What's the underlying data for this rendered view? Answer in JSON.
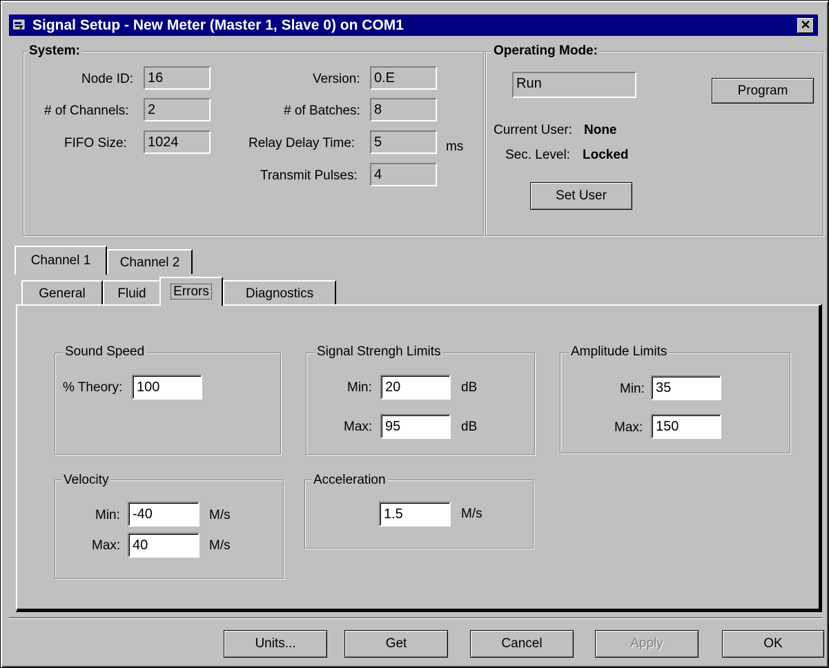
{
  "window": {
    "title": "Signal Setup - New Meter (Master 1, Slave 0) on COM1",
    "close": "✕"
  },
  "system": {
    "group_label": "System:",
    "node_id_label": "Node ID:",
    "node_id": "16",
    "channels_label": "# of Channels:",
    "channels": "2",
    "fifo_label": "FIFO Size:",
    "fifo": "1024",
    "version_label": "Version:",
    "version": "0.E",
    "batches_label": "# of Batches:",
    "batches": "8",
    "relay_label": "Relay Delay Time:",
    "relay": "5",
    "relay_unit": "ms",
    "pulses_label": "Transmit Pulses:",
    "pulses": "4"
  },
  "operating_mode": {
    "group_label": "Operating Mode:",
    "mode": "Run",
    "program_button": "Program",
    "current_user_label": "Current User:",
    "current_user": "None",
    "sec_level_label": "Sec. Level:",
    "sec_level": "Locked",
    "set_user_button": "Set User"
  },
  "channel_tabs": [
    "Channel 1",
    "Channel 2"
  ],
  "sub_tabs": [
    "General",
    "Fluid",
    "Errors",
    "Diagnostics"
  ],
  "errors": {
    "sound_speed": {
      "label": "Sound Speed",
      "theory_label": "% Theory:",
      "theory": "100"
    },
    "signal_strength": {
      "label": "Signal Strengh Limits",
      "min_label": "Min:",
      "min": "20",
      "max_label": "Max:",
      "max": "95",
      "unit": "dB"
    },
    "amplitude": {
      "label": "Amplitude Limits",
      "min_label": "Min:",
      "min": "35",
      "max_label": "Max:",
      "max": "150"
    },
    "velocity": {
      "label": "Velocity",
      "min_label": "Min:",
      "min": "-40",
      "max_label": "Max:",
      "max": "40",
      "unit": "M/s"
    },
    "acceleration": {
      "label": "Acceleration",
      "value": "1.5",
      "unit": "M/s"
    }
  },
  "buttons": {
    "units": "Units...",
    "get": "Get",
    "cancel": "Cancel",
    "apply": "Apply",
    "ok": "OK"
  },
  "colors": {
    "titlebar": "#000080",
    "face": "#c0c0c0",
    "disabled_text": "#808080"
  }
}
